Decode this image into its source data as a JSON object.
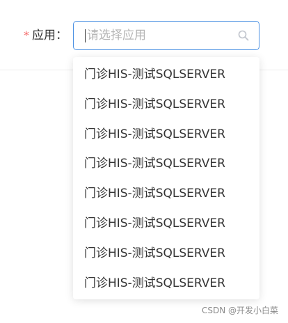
{
  "form": {
    "required_mark": "*",
    "label": "应用：",
    "select": {
      "placeholder": "请选择应用",
      "icon": "search-icon"
    }
  },
  "dropdown": {
    "options": [
      {
        "label": "门诊HIS-测试SQLSERVER"
      },
      {
        "label": "门诊HIS-测试SQLSERVER"
      },
      {
        "label": "门诊HIS-测试SQLSERVER"
      },
      {
        "label": "门诊HIS-测试SQLSERVER"
      },
      {
        "label": "门诊HIS-测试SQLSERVER"
      },
      {
        "label": "门诊HIS-测试SQLSERVER"
      },
      {
        "label": "门诊HIS-测试SQLSERVER"
      },
      {
        "label": "门诊HIS-测试SQLSERVER"
      }
    ]
  },
  "watermark": "CSDN @开发小白菜",
  "colors": {
    "focus_border": "#4a90e2",
    "required": "#f56c6c",
    "text": "#333333",
    "placeholder": "#b4b4b4"
  }
}
